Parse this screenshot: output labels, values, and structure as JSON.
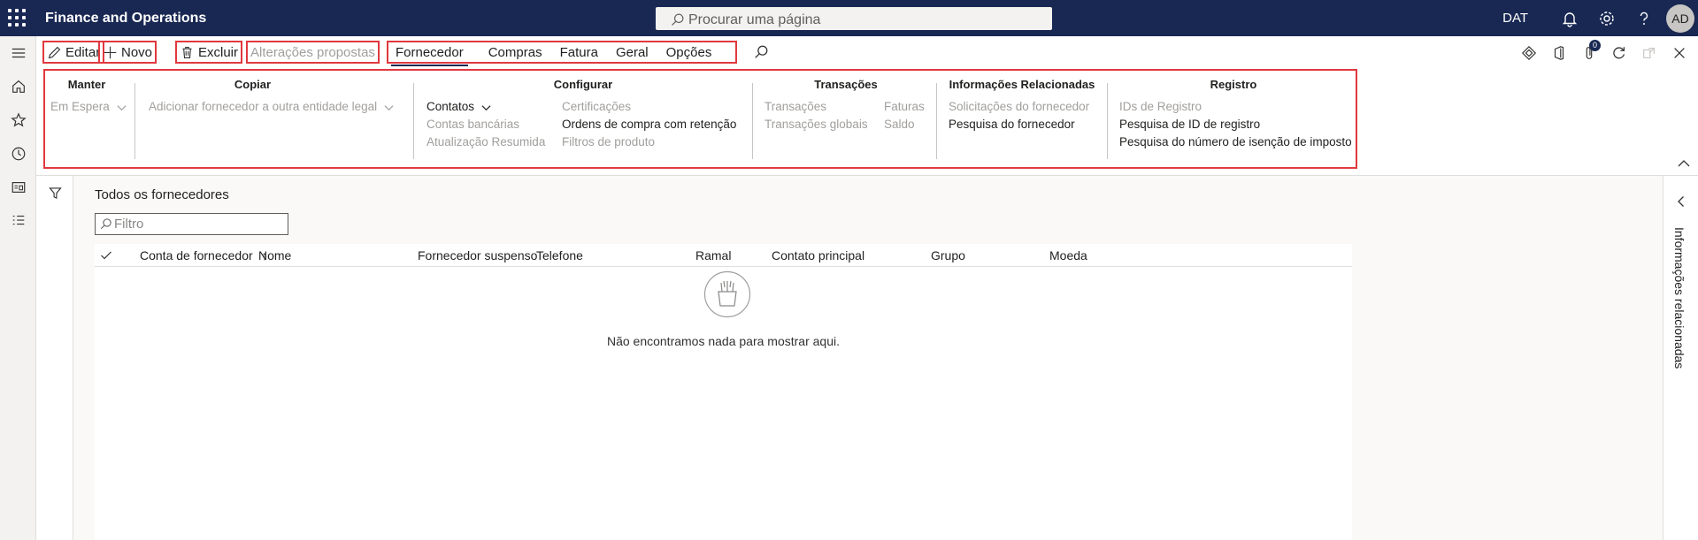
{
  "app": {
    "title": "Finance and Operations",
    "search_placeholder": "Procurar uma página",
    "company": "DAT",
    "avatar_initials": "AD"
  },
  "actions": {
    "edit": "Editar",
    "new": "Novo",
    "delete": "Excluir",
    "proposed_changes": "Alterações propostas"
  },
  "tabs": [
    "Fornecedor",
    "Compras",
    "Fatura",
    "Geral",
    "Opções"
  ],
  "active_tab": "Fornecedor",
  "notification_count": "0",
  "ribbon": {
    "manter": {
      "title": "Manter",
      "items": [
        "Em Espera"
      ]
    },
    "copiar": {
      "title": "Copiar",
      "items": [
        "Adicionar fornecedor a outra entidade legal"
      ]
    },
    "configurar": {
      "title": "Configurar",
      "col1": [
        "Contatos",
        "Contas bancárias",
        "Atualização Resumida"
      ],
      "col2": [
        "Certificações",
        "Ordens de compra com retenção",
        "Filtros de produto"
      ]
    },
    "transacoes": {
      "title": "Transações",
      "col1": [
        "Transações",
        "Transações globais"
      ],
      "col2": [
        "Faturas",
        "Saldo"
      ]
    },
    "info": {
      "title": "Informações Relacionadas",
      "items": [
        "Solicitações do fornecedor",
        "Pesquisa do fornecedor"
      ]
    },
    "registro": {
      "title": "Registro",
      "items": [
        "IDs de Registro",
        "Pesquisa de ID de registro",
        "Pesquisa do número de isenção de imposto"
      ]
    }
  },
  "grid": {
    "title": "Todos os fornecedores",
    "filter_placeholder": "Filtro",
    "sort_arrow": "↑",
    "columns": [
      "Conta de fornecedor",
      "Nome",
      "Fornecedor suspenso",
      "Telefone",
      "Ramal",
      "Contato principal",
      "Grupo",
      "Moeda"
    ],
    "empty_message": "Não encontramos nada para mostrar aqui."
  },
  "right_pane": {
    "label": "Informações relacionadas"
  }
}
